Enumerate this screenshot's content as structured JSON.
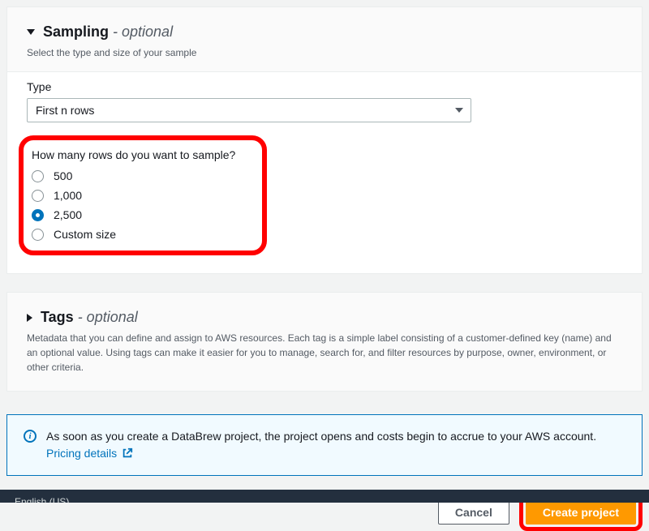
{
  "sampling": {
    "title": "Sampling",
    "optional": " - optional",
    "description": "Select the type and size of your sample",
    "type_label": "Type",
    "type_value": "First n rows",
    "rows_question": "How many rows do you want to sample?",
    "options": [
      {
        "label": "500",
        "selected": false
      },
      {
        "label": "1,000",
        "selected": false
      },
      {
        "label": "2,500",
        "selected": true
      },
      {
        "label": "Custom size",
        "selected": false
      }
    ]
  },
  "tags": {
    "title": "Tags",
    "optional": " - optional",
    "description": "Metadata that you can define and assign to AWS resources. Each tag is a simple label consisting of a customer-defined key (name) and an optional value. Using tags can make it easier for you to manage, search for, and filter resources by purpose, owner, environment, or other criteria."
  },
  "info": {
    "text": "As soon as you create a DataBrew project, the project opens and costs begin to accrue to your AWS account. ",
    "link_label": "Pricing details"
  },
  "actions": {
    "cancel": "Cancel",
    "create": "Create project"
  },
  "bottombar": {
    "lang": "English (US)"
  }
}
